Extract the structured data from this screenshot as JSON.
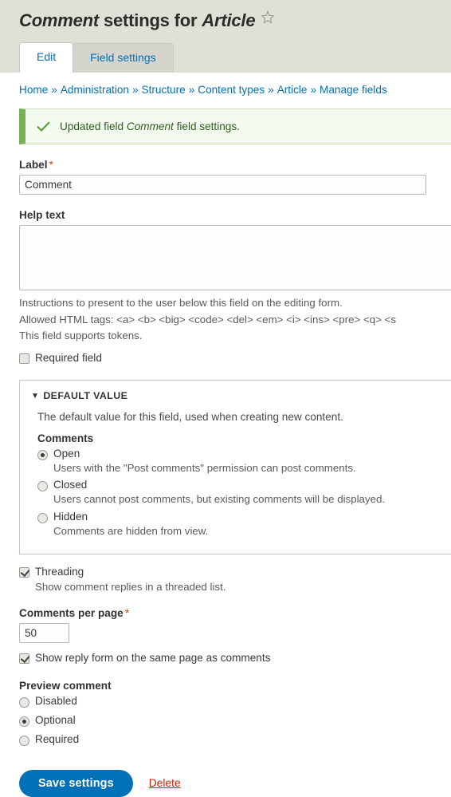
{
  "header": {
    "title_prefix_em": "Comment",
    "title_mid": " settings for ",
    "title_suffix_em": "Article",
    "star_icon": "star-outline-icon",
    "bg_color": "#e0e0d8"
  },
  "tabs": [
    {
      "label": "Edit",
      "active": true
    },
    {
      "label": "Field settings",
      "active": false
    }
  ],
  "breadcrumb": {
    "separator": "»",
    "items": [
      "Home",
      "Administration",
      "Structure",
      "Content types",
      "Article",
      "Manage fields"
    ]
  },
  "message": {
    "icon": "checkmark-icon",
    "text_before": "Updated field ",
    "text_em": "Comment",
    "text_after": " field settings.",
    "accent_color": "#77b259",
    "bg_color": "#f3faef"
  },
  "form": {
    "label_field": {
      "label": "Label",
      "required_marker": "*",
      "value": "Comment"
    },
    "help_text_field": {
      "label": "Help text",
      "value": "",
      "descriptions": [
        "Instructions to present to the user below this field on the editing form.",
        "Allowed HTML tags: <a> <b> <big> <code> <del> <em> <i> <ins> <pre> <q> <s",
        "This field supports tokens."
      ]
    },
    "required_field": {
      "label": "Required field",
      "checked": false
    },
    "default_value": {
      "summary": "DEFAULT VALUE",
      "triangle": "▼",
      "intro": "The default value for this field, used when creating new content.",
      "group_label": "Comments",
      "options": [
        {
          "label": "Open",
          "description": "Users with the \"Post comments\" permission can post comments.",
          "selected": true
        },
        {
          "label": "Closed",
          "description": "Users cannot post comments, but existing comments will be displayed.",
          "selected": false
        },
        {
          "label": "Hidden",
          "description": "Comments are hidden from view.",
          "selected": false
        }
      ]
    },
    "threading": {
      "label": "Threading",
      "description": "Show comment replies in a threaded list.",
      "checked": true
    },
    "comments_per_page": {
      "label": "Comments per page",
      "required_marker": "*",
      "value": "50"
    },
    "show_reply_form": {
      "label": "Show reply form on the same page as comments",
      "checked": true
    },
    "preview_comment": {
      "label": "Preview comment",
      "options": [
        {
          "label": "Disabled",
          "selected": false
        },
        {
          "label": "Optional",
          "selected": true
        },
        {
          "label": "Required",
          "selected": false
        }
      ]
    }
  },
  "actions": {
    "save_label": "Save settings",
    "delete_label": "Delete",
    "primary_color": "#0071b8",
    "delete_color": "#c72100"
  }
}
